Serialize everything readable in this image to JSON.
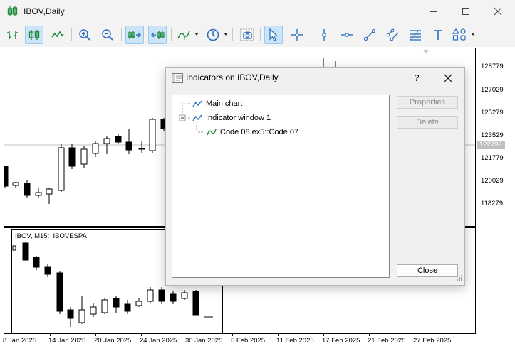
{
  "window": {
    "title": "IBOV,Daily"
  },
  "toolbar": {
    "icons": [
      "bar-chart-icon",
      "candlestick-icon",
      "line-chart-icon",
      "zoom-in-icon",
      "zoom-out-icon",
      "auto-scroll-icon",
      "chart-shift-icon",
      "indicators-icon",
      "timeframe-icon",
      "screenshot-icon",
      "cursor-icon",
      "crosshair-icon",
      "vertical-line-icon",
      "horizontal-line-icon",
      "trendline-icon",
      "channel-icon",
      "fibonacci-icon",
      "text-icon",
      "shapes-icon"
    ]
  },
  "chart": {
    "price_labels": [
      "128779",
      "127029",
      "125279",
      "123529",
      "122799",
      "121779",
      "120029",
      "118279"
    ],
    "highlighted_price": "122799",
    "date_labels": [
      "8 Jan 2025",
      "14 Jan 2025",
      "20 Jan 2025",
      "24 Jan 2025",
      "30 Jan 2025",
      "5 Feb 2025",
      "11 Feb 2025",
      "17 Feb 2025",
      "21 Feb 2025",
      "27 Feb 2025"
    ],
    "subwindow_label": "IBOV, M15:  IBOVESPA",
    "colors": {
      "bull": "#ffffff",
      "bear": "#000000",
      "price_line": "#c0c0c0"
    }
  },
  "dialog": {
    "title": "Indicators on IBOV,Daily",
    "help_label": "?",
    "tree": {
      "main_chart": "Main chart",
      "indicator_window": "Indicator window 1",
      "indicator": "Code 08.ex5::Code 07"
    },
    "buttons": {
      "properties": "Properties",
      "delete": "Delete",
      "close": "Close"
    }
  }
}
